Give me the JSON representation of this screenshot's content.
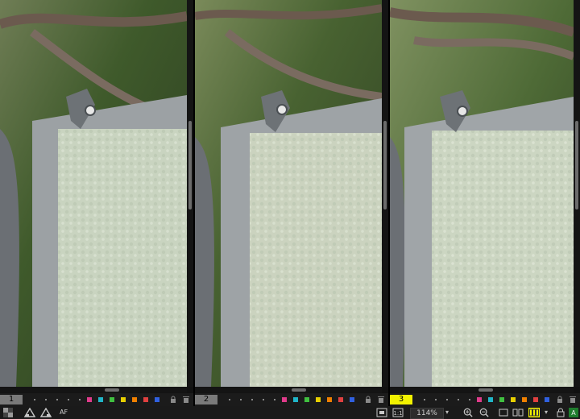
{
  "panels": [
    {
      "number": "1",
      "active": false
    },
    {
      "number": "2",
      "active": false
    },
    {
      "number": "3",
      "active": true
    }
  ],
  "color_labels": [
    "#e03b8b",
    "#20b6c8",
    "#40c040",
    "#e8d000",
    "#f08000",
    "#e04040",
    "#3060e0"
  ],
  "toolbar": {
    "af_label": "AF",
    "zoom_value": "114%",
    "zoom_caret": "▾",
    "grid_caret": "▾"
  },
  "icons": {
    "lock": "lock-icon",
    "trash": "trash-icon"
  },
  "colors": {
    "active_panel": "#f2f200",
    "inactive_panel": "#7a7a7a",
    "grid_highlight": "#f2f200"
  }
}
